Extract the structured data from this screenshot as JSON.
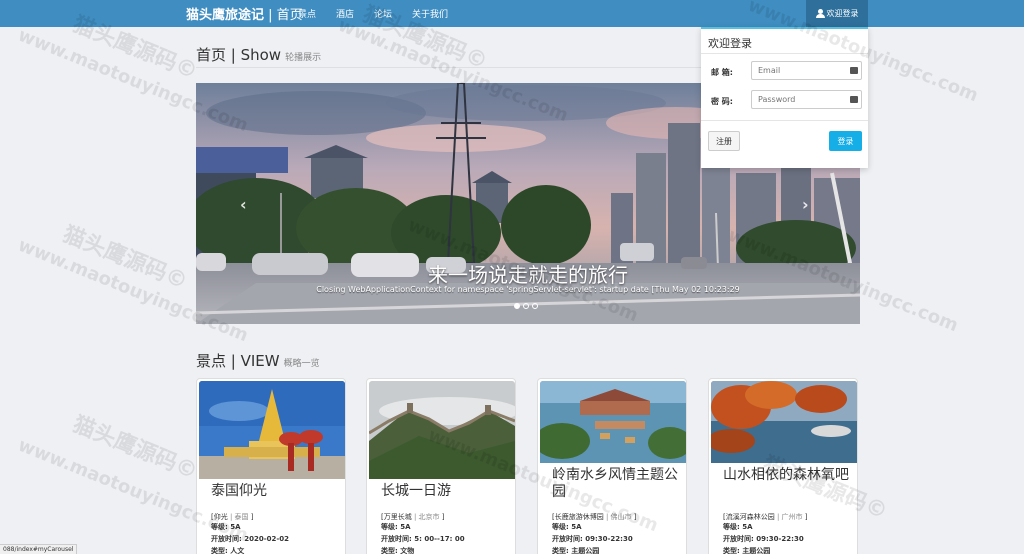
{
  "navbar": {
    "brand_bold": "猫头鹰旅途记",
    "brand_sep": " | ",
    "brand_page": "首页",
    "links": [
      "景点",
      "酒店",
      "论坛",
      "关于我们"
    ],
    "login_toggle": "欢迎登录"
  },
  "show_section": {
    "title": "首页 | Show",
    "subtitle": "轮播展示"
  },
  "carousel": {
    "caption": "来一场说走就走的旅行",
    "sub_caption": "Closing WebApplicationContext for namespace 'springServlet-servlet': startup date [Thu May 02 10:23:29",
    "prev": "‹",
    "next": "›",
    "slides": 3,
    "active_slide": 1
  },
  "login_panel": {
    "title": "欢迎登录",
    "email_label": "邮 箱:",
    "email_placeholder": "Email",
    "password_label": "密 码:",
    "password_placeholder": "Password",
    "register_button": "注册",
    "login_button": "登录"
  },
  "view_section": {
    "title": "景点 | VIEW",
    "subtitle": "概略一览"
  },
  "cards": [
    {
      "title": "泰国仰光",
      "tag": "[仰光",
      "tag_city": "| 泰国",
      "tag_end": "]",
      "level": "等级: 5A",
      "open_time": "开放时间: 2020-02-02",
      "type": "类型: 人文"
    },
    {
      "title": "长城一日游",
      "tag": "[万里长城",
      "tag_city": "| 北京市",
      "tag_end": "]",
      "level": "等级: 5A",
      "open_time": "开放时间: 5: 00--17: 00",
      "type": "类型: 文物"
    },
    {
      "title": "岭南水乡风情主题公园",
      "tag": "[长鹿旅游休博园",
      "tag_city": "| 佛山市",
      "tag_end": "]",
      "level": "等级: 5A",
      "open_time": "开放时间: 09:30-22:30",
      "type": "类型: 主题公园"
    },
    {
      "title": "山水相依的森林氧吧",
      "tag": "[流溪河森林公园",
      "tag_city": "| 广州市",
      "tag_end": "]",
      "level": "等级: 5A",
      "open_time": "开放时间: 09:30-22:30",
      "type": "类型: 主题公园"
    }
  ],
  "watermark": {
    "cn": "猫头鹰源码©",
    "url": "www.maotouyingcc.com"
  },
  "status_bar": "088/index#myCarousel",
  "colors": {
    "navbar": "#3f8dc1",
    "login_btn": "#16aee6",
    "panel_accent": "#5bc0de"
  }
}
